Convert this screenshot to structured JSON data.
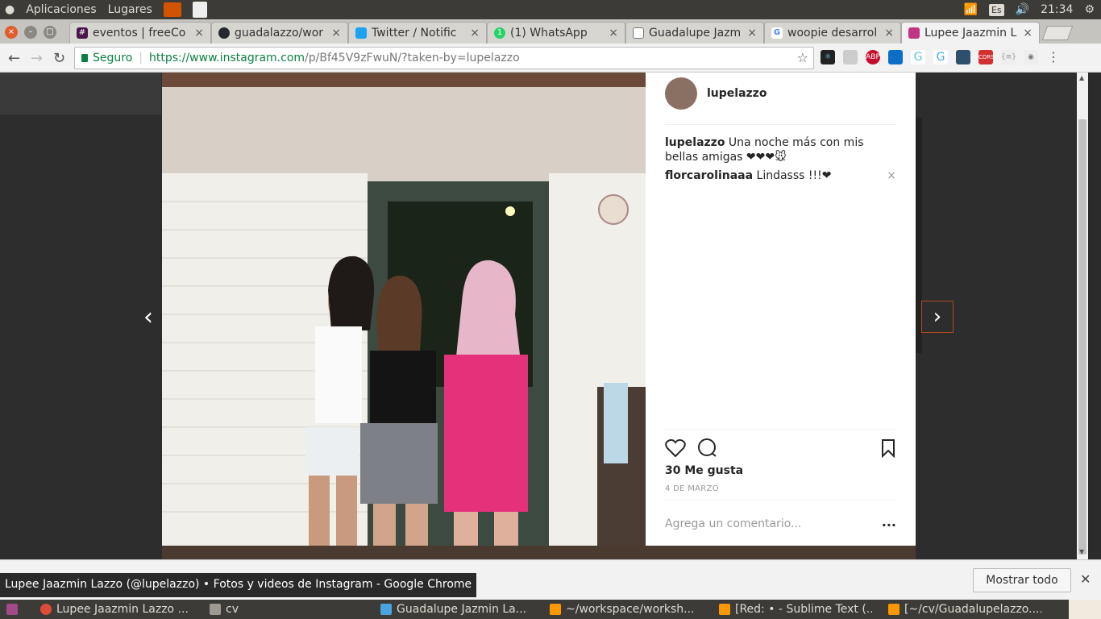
{
  "topbar": {
    "menu_apps": "Aplicaciones",
    "menu_places": "Lugares",
    "keyboard": "Es",
    "clock": "21:34"
  },
  "tabs": [
    {
      "title": "eventos | freeCo",
      "icon": "slack-icon",
      "color": "#4a154b"
    },
    {
      "title": "guadalazzo/wor",
      "icon": "github-icon",
      "color": "#24292e"
    },
    {
      "title": "Twitter / Notific",
      "icon": "twitter-icon",
      "color": "#1da1f2"
    },
    {
      "title": "(1) WhatsApp",
      "icon": "whatsapp-icon",
      "color": "#25d366"
    },
    {
      "title": "Guadalupe Jazm",
      "icon": "document-icon",
      "color": "#777777"
    },
    {
      "title": "woopie desarrol",
      "icon": "google-icon",
      "color": "#4285f4"
    },
    {
      "title": "Lupee Jaazmin L",
      "icon": "instagram-icon",
      "color": "#c13584"
    }
  ],
  "address": {
    "secure_label": "Seguro",
    "url_main": "https://www.instagram.com",
    "url_path": "/p/Bf45V9zFwuN/?taken-by=lupelazzo"
  },
  "post": {
    "username": "lupelazzo",
    "caption_user": "lupelazzo",
    "caption_text": "Una noche más con mis bellas amigas ❤❤❤🐭",
    "comment_user": "florcarolinaaa",
    "comment_text": "Lindasss !!!❤",
    "likes": "30 Me gusta",
    "date": "4 DE MARZO",
    "add_comment_placeholder": "Agrega un comentario...",
    "more": "..."
  },
  "tooltip": "Lupee Jaazmin Lazzo (@lupelazzo) • Fotos y videos de Instagram - Google Chrome",
  "download_bar": {
    "show_all": "Mostrar todo"
  },
  "taskbar": [
    {
      "title": "Lupee Jaazmin Lazzo ...",
      "icon": "chrome-icon"
    },
    {
      "title": "cv",
      "icon": "folder-icon"
    },
    {
      "title": "Guadalupe Jazmin La...",
      "icon": "document-icon"
    },
    {
      "title": "~/workspace/worksh...",
      "icon": "sublime-icon"
    },
    {
      "title": "[Red: • - Sublime Text (...",
      "icon": "sublime-icon"
    },
    {
      "title": "[~/cv/Guadalupelazzo....",
      "icon": "sublime-icon"
    }
  ]
}
